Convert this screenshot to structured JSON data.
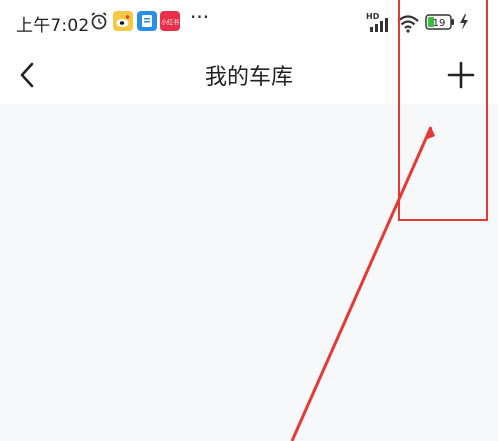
{
  "status_bar": {
    "time": "上午7:02",
    "network": "HD",
    "battery_level": "19",
    "icons": [
      "alarm-icon",
      "weibo-icon",
      "app-icon",
      "xiaohongshu-icon",
      "more-dots-icon",
      "signal-icon",
      "wifi-icon",
      "battery-icon",
      "charging-icon"
    ],
    "more": "···",
    "small_red_app_text": "小红书"
  },
  "header": {
    "title": "我的车库",
    "back_icon": "chevron-left-icon",
    "add_icon": "plus-icon"
  },
  "colors": {
    "background": "#f7f8fa",
    "header_background": "#ffffff",
    "annotation": "#e53935",
    "text": "#222222",
    "battery": "#3bbf3b"
  }
}
